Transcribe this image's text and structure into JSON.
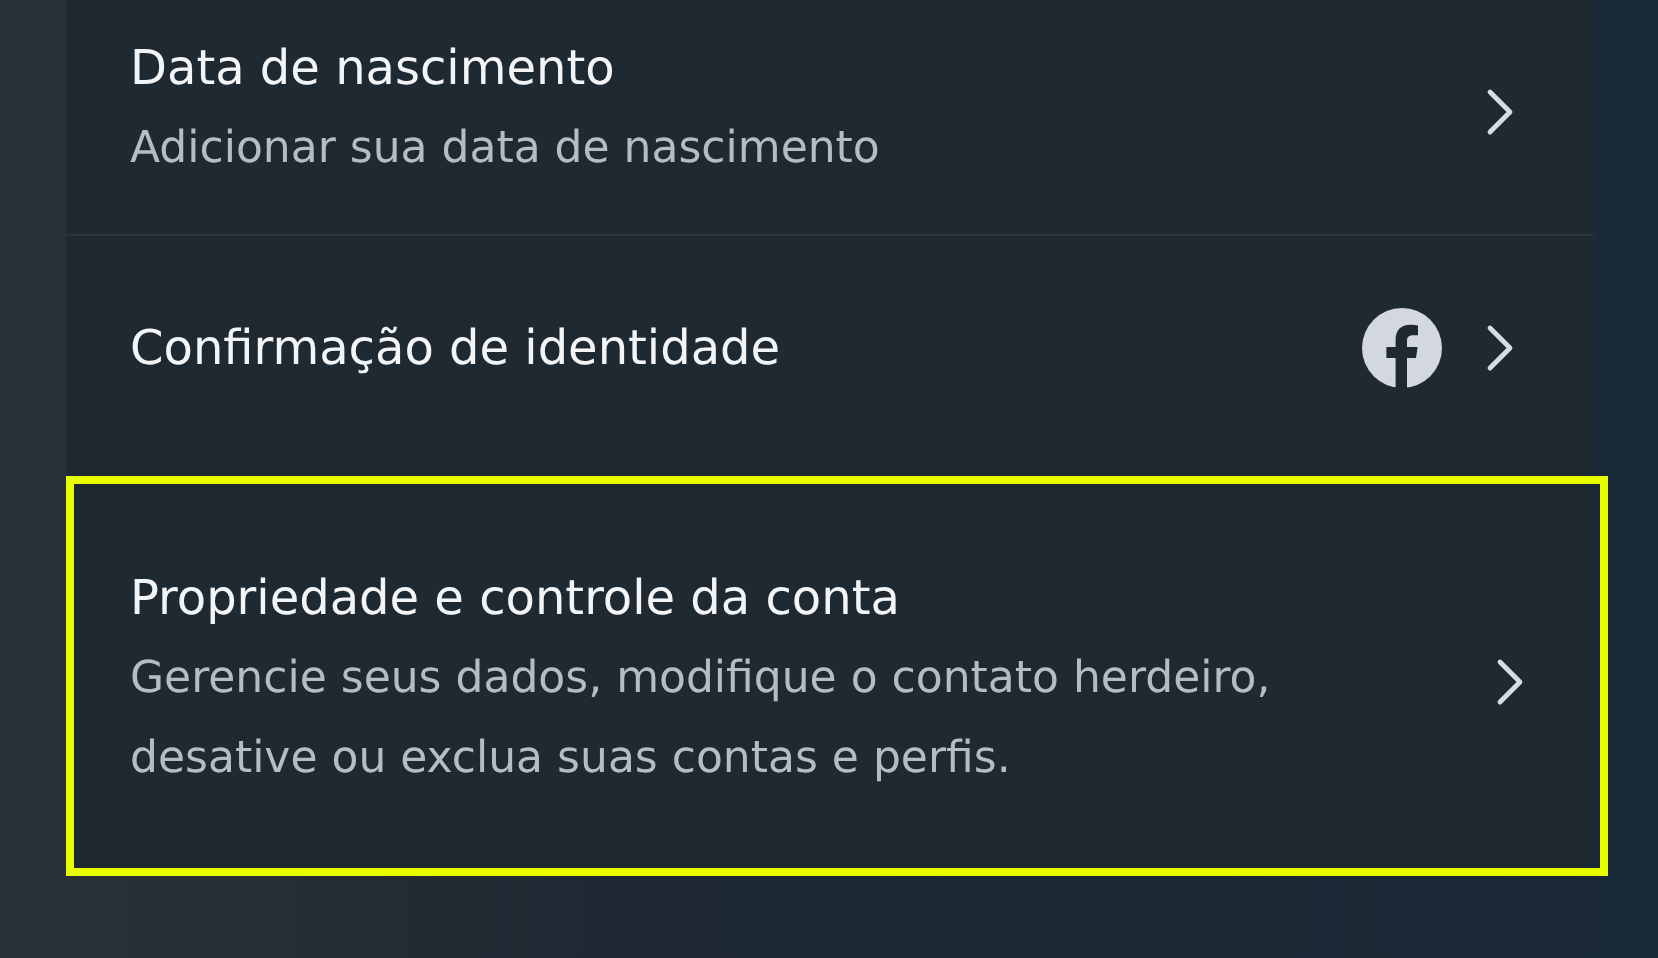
{
  "settings_items": [
    {
      "title": "Data de nascimento",
      "subtitle": "Adicionar sua data de nascimento",
      "kind": "plain",
      "highlighted": false
    },
    {
      "title": "Confirmação de identidade",
      "kind": "facebook",
      "highlighted": false
    },
    {
      "title": "Propriedade e controle da conta",
      "subtitle": "Gerencie seus dados, modifique o contato herdeiro, desative ou exclua suas contas e perfis.",
      "kind": "plain",
      "highlighted": true
    }
  ]
}
